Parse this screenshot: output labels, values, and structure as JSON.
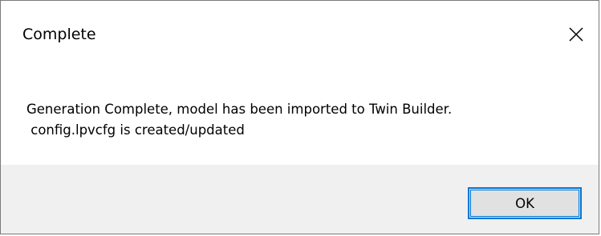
{
  "dialog": {
    "title": "Complete",
    "close_icon": "close-icon",
    "message_line1": "Generation Complete, model has been imported to Twin Builder.",
    "message_line2": " config.lpvcfg is created/updated",
    "ok_label": "OK"
  },
  "colors": {
    "accent": "#0078d7",
    "footer_bg": "#f0f0f0",
    "button_bg": "#e1e1e1",
    "border": "#7a7a7a"
  }
}
